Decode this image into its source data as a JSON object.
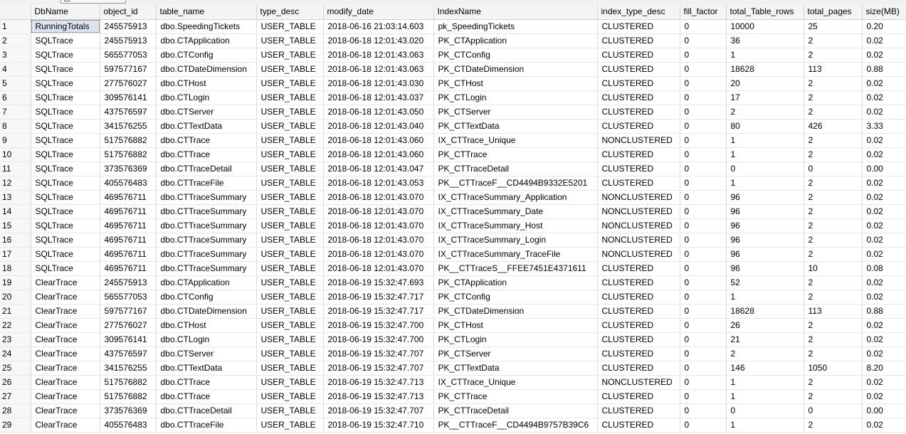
{
  "columns": [
    "",
    "DbName",
    "object_id",
    "table_name",
    "type_desc",
    "modify_date",
    "IndexName",
    "index_type_desc",
    "fill_factor",
    "total_Table_rows",
    "total_pages",
    "size(MB)"
  ],
  "rows": [
    [
      "1",
      "RunningTotals",
      "245575913",
      "dbo.SpeedingTickets",
      "USER_TABLE",
      "2018-06-16 21:03:14.603",
      "pk_SpeedingTickets",
      "CLUSTERED",
      "0",
      "10000",
      "25",
      "0.20"
    ],
    [
      "2",
      "SQLTrace",
      "245575913",
      "dbo.CTApplication",
      "USER_TABLE",
      "2018-06-18 12:01:43.020",
      "PK_CTApplication",
      "CLUSTERED",
      "0",
      "36",
      "2",
      "0.02"
    ],
    [
      "3",
      "SQLTrace",
      "565577053",
      "dbo.CTConfig",
      "USER_TABLE",
      "2018-06-18 12:01:43.063",
      "PK_CTConfig",
      "CLUSTERED",
      "0",
      "1",
      "2",
      "0.02"
    ],
    [
      "4",
      "SQLTrace",
      "597577167",
      "dbo.CTDateDimension",
      "USER_TABLE",
      "2018-06-18 12:01:43.063",
      "PK_CTDateDimension",
      "CLUSTERED",
      "0",
      "18628",
      "113",
      "0.88"
    ],
    [
      "5",
      "SQLTrace",
      "277576027",
      "dbo.CTHost",
      "USER_TABLE",
      "2018-06-18 12:01:43.030",
      "PK_CTHost",
      "CLUSTERED",
      "0",
      "20",
      "2",
      "0.02"
    ],
    [
      "6",
      "SQLTrace",
      "309576141",
      "dbo.CTLogin",
      "USER_TABLE",
      "2018-06-18 12:01:43.037",
      "PK_CTLogin",
      "CLUSTERED",
      "0",
      "17",
      "2",
      "0.02"
    ],
    [
      "7",
      "SQLTrace",
      "437576597",
      "dbo.CTServer",
      "USER_TABLE",
      "2018-06-18 12:01:43.050",
      "PK_CTServer",
      "CLUSTERED",
      "0",
      "2",
      "2",
      "0.02"
    ],
    [
      "8",
      "SQLTrace",
      "341576255",
      "dbo.CTTextData",
      "USER_TABLE",
      "2018-06-18 12:01:43.040",
      "PK_CTTextData",
      "CLUSTERED",
      "0",
      "80",
      "426",
      "3.33"
    ],
    [
      "9",
      "SQLTrace",
      "517576882",
      "dbo.CTTrace",
      "USER_TABLE",
      "2018-06-18 12:01:43.060",
      "IX_CTTrace_Unique",
      "NONCLUSTERED",
      "0",
      "1",
      "2",
      "0.02"
    ],
    [
      "10",
      "SQLTrace",
      "517576882",
      "dbo.CTTrace",
      "USER_TABLE",
      "2018-06-18 12:01:43.060",
      "PK_CTTrace",
      "CLUSTERED",
      "0",
      "1",
      "2",
      "0.02"
    ],
    [
      "11",
      "SQLTrace",
      "373576369",
      "dbo.CTTraceDetail",
      "USER_TABLE",
      "2018-06-18 12:01:43.047",
      "PK_CTTraceDetail",
      "CLUSTERED",
      "0",
      "0",
      "0",
      "0.00"
    ],
    [
      "12",
      "SQLTrace",
      "405576483",
      "dbo.CTTraceFile",
      "USER_TABLE",
      "2018-06-18 12:01:43.053",
      "PK__CTTraceF__CD4494B9332E5201",
      "CLUSTERED",
      "0",
      "1",
      "2",
      "0.02"
    ],
    [
      "13",
      "SQLTrace",
      "469576711",
      "dbo.CTTraceSummary",
      "USER_TABLE",
      "2018-06-18 12:01:43.070",
      "IX_CTTraceSummary_Application",
      "NONCLUSTERED",
      "0",
      "96",
      "2",
      "0.02"
    ],
    [
      "14",
      "SQLTrace",
      "469576711",
      "dbo.CTTraceSummary",
      "USER_TABLE",
      "2018-06-18 12:01:43.070",
      "IX_CTTraceSummary_Date",
      "NONCLUSTERED",
      "0",
      "96",
      "2",
      "0.02"
    ],
    [
      "15",
      "SQLTrace",
      "469576711",
      "dbo.CTTraceSummary",
      "USER_TABLE",
      "2018-06-18 12:01:43.070",
      "IX_CTTraceSummary_Host",
      "NONCLUSTERED",
      "0",
      "96",
      "2",
      "0.02"
    ],
    [
      "16",
      "SQLTrace",
      "469576711",
      "dbo.CTTraceSummary",
      "USER_TABLE",
      "2018-06-18 12:01:43.070",
      "IX_CTTraceSummary_Login",
      "NONCLUSTERED",
      "0",
      "96",
      "2",
      "0.02"
    ],
    [
      "17",
      "SQLTrace",
      "469576711",
      "dbo.CTTraceSummary",
      "USER_TABLE",
      "2018-06-18 12:01:43.070",
      "IX_CTTraceSummary_TraceFile",
      "NONCLUSTERED",
      "0",
      "96",
      "2",
      "0.02"
    ],
    [
      "18",
      "SQLTrace",
      "469576711",
      "dbo.CTTraceSummary",
      "USER_TABLE",
      "2018-06-18 12:01:43.070",
      "PK__CTTraceS__FFEE7451E4371611",
      "CLUSTERED",
      "0",
      "96",
      "10",
      "0.08"
    ],
    [
      "19",
      "ClearTrace",
      "245575913",
      "dbo.CTApplication",
      "USER_TABLE",
      "2018-06-19 15:32:47.693",
      "PK_CTApplication",
      "CLUSTERED",
      "0",
      "52",
      "2",
      "0.02"
    ],
    [
      "20",
      "ClearTrace",
      "565577053",
      "dbo.CTConfig",
      "USER_TABLE",
      "2018-06-19 15:32:47.717",
      "PK_CTConfig",
      "CLUSTERED",
      "0",
      "1",
      "2",
      "0.02"
    ],
    [
      "21",
      "ClearTrace",
      "597577167",
      "dbo.CTDateDimension",
      "USER_TABLE",
      "2018-06-19 15:32:47.717",
      "PK_CTDateDimension",
      "CLUSTERED",
      "0",
      "18628",
      "113",
      "0.88"
    ],
    [
      "22",
      "ClearTrace",
      "277576027",
      "dbo.CTHost",
      "USER_TABLE",
      "2018-06-19 15:32:47.700",
      "PK_CTHost",
      "CLUSTERED",
      "0",
      "26",
      "2",
      "0.02"
    ],
    [
      "23",
      "ClearTrace",
      "309576141",
      "dbo.CTLogin",
      "USER_TABLE",
      "2018-06-19 15:32:47.700",
      "PK_CTLogin",
      "CLUSTERED",
      "0",
      "21",
      "2",
      "0.02"
    ],
    [
      "24",
      "ClearTrace",
      "437576597",
      "dbo.CTServer",
      "USER_TABLE",
      "2018-06-19 15:32:47.707",
      "PK_CTServer",
      "CLUSTERED",
      "0",
      "2",
      "2",
      "0.02"
    ],
    [
      "25",
      "ClearTrace",
      "341576255",
      "dbo.CTTextData",
      "USER_TABLE",
      "2018-06-19 15:32:47.707",
      "PK_CTTextData",
      "CLUSTERED",
      "0",
      "146",
      "1050",
      "8.20"
    ],
    [
      "26",
      "ClearTrace",
      "517576882",
      "dbo.CTTrace",
      "USER_TABLE",
      "2018-06-19 15:32:47.713",
      "IX_CTTrace_Unique",
      "NONCLUSTERED",
      "0",
      "1",
      "2",
      "0.02"
    ],
    [
      "27",
      "ClearTrace",
      "517576882",
      "dbo.CTTrace",
      "USER_TABLE",
      "2018-06-19 15:32:47.713",
      "PK_CTTrace",
      "CLUSTERED",
      "0",
      "1",
      "2",
      "0.02"
    ],
    [
      "28",
      "ClearTrace",
      "373576369",
      "dbo.CTTraceDetail",
      "USER_TABLE",
      "2018-06-19 15:32:47.707",
      "PK_CTTraceDetail",
      "CLUSTERED",
      "0",
      "0",
      "0",
      "0.00"
    ],
    [
      "29",
      "ClearTrace",
      "405576483",
      "dbo.CTTraceFile",
      "USER_TABLE",
      "2018-06-19 15:32:47.710",
      "PK__CTTraceF__CD4494B9757B39C6",
      "CLUSTERED",
      "0",
      "1",
      "2",
      "0.02"
    ]
  ],
  "selected_cell": {
    "row": 0,
    "column": 1
  },
  "colors": {
    "header_bg": "#f4f4f4",
    "rownum_bg": "#f7f7f7",
    "gridline": "#dcdcdc",
    "selection": "#dbe4ef"
  }
}
